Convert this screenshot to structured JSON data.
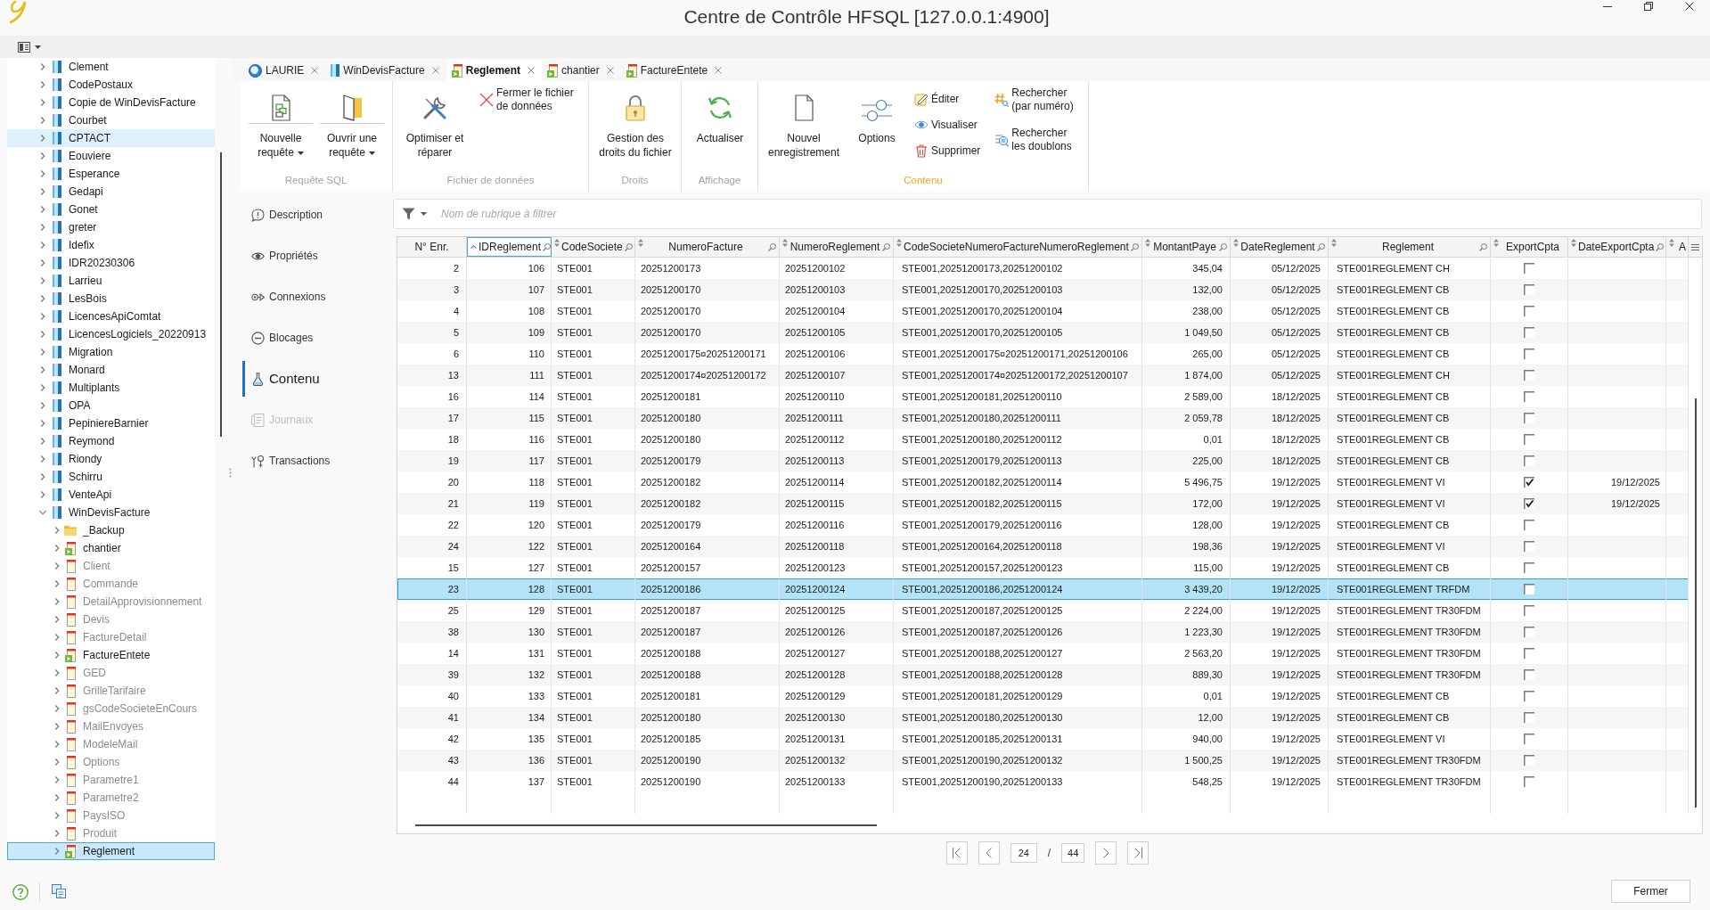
{
  "window": {
    "title": "Centre de Contrôle HFSQL [127.0.0.1:4900]"
  },
  "tree": {
    "items": [
      {
        "label": "Clement",
        "kind": "database",
        "expanded": false,
        "selected": false,
        "hovered": false
      },
      {
        "label": "CodePostaux",
        "kind": "database",
        "expanded": false,
        "selected": false,
        "hovered": false
      },
      {
        "label": "Copie de WinDevisFacture",
        "kind": "database",
        "expanded": false,
        "selected": false,
        "hovered": false
      },
      {
        "label": "Courbet",
        "kind": "database",
        "expanded": false,
        "selected": false,
        "hovered": false
      },
      {
        "label": "CPTACT",
        "kind": "database",
        "expanded": false,
        "selected": false,
        "hovered": true
      },
      {
        "label": "Eouviere",
        "kind": "database",
        "expanded": false,
        "selected": false,
        "hovered": false
      },
      {
        "label": "Esperance",
        "kind": "database",
        "expanded": false,
        "selected": false,
        "hovered": false
      },
      {
        "label": "Gedapi",
        "kind": "database",
        "expanded": false,
        "selected": false,
        "hovered": false
      },
      {
        "label": "Gonet",
        "kind": "database",
        "expanded": false,
        "selected": false,
        "hovered": false
      },
      {
        "label": "greter",
        "kind": "database",
        "expanded": false,
        "selected": false,
        "hovered": false
      },
      {
        "label": "Idefix",
        "kind": "database",
        "expanded": false,
        "selected": false,
        "hovered": false
      },
      {
        "label": "IDR20230306",
        "kind": "database",
        "expanded": false,
        "selected": false,
        "hovered": false
      },
      {
        "label": "Larrieu",
        "kind": "database",
        "expanded": false,
        "selected": false,
        "hovered": false
      },
      {
        "label": "LesBois",
        "kind": "database",
        "expanded": false,
        "selected": false,
        "hovered": false
      },
      {
        "label": "LicencesApiComtat",
        "kind": "database",
        "expanded": false,
        "selected": false,
        "hovered": false
      },
      {
        "label": "LicencesLogiciels_20220913",
        "kind": "database",
        "expanded": false,
        "selected": false,
        "hovered": false
      },
      {
        "label": "Migration",
        "kind": "database",
        "expanded": false,
        "selected": false,
        "hovered": false
      },
      {
        "label": "Monard",
        "kind": "database",
        "expanded": false,
        "selected": false,
        "hovered": false
      },
      {
        "label": "Multiplants",
        "kind": "database",
        "expanded": false,
        "selected": false,
        "hovered": false
      },
      {
        "label": "OPA",
        "kind": "database",
        "expanded": false,
        "selected": false,
        "hovered": false
      },
      {
        "label": "PepiniereBarnier",
        "kind": "database",
        "expanded": false,
        "selected": false,
        "hovered": false
      },
      {
        "label": "Reymond",
        "kind": "database",
        "expanded": false,
        "selected": false,
        "hovered": false
      },
      {
        "label": "Riondy",
        "kind": "database",
        "expanded": false,
        "selected": false,
        "hovered": false
      },
      {
        "label": "Schirru",
        "kind": "database",
        "expanded": false,
        "selected": false,
        "hovered": false
      },
      {
        "label": "VenteApi",
        "kind": "database",
        "expanded": false,
        "selected": false,
        "hovered": false
      },
      {
        "label": "WinDevisFacture",
        "kind": "database",
        "expanded": true,
        "selected": false,
        "hovered": false,
        "children": [
          {
            "label": "_Backup",
            "kind": "folder",
            "expanded": false,
            "selected": false,
            "hovered": false
          },
          {
            "label": "chantier",
            "kind": "file",
            "open": true,
            "expanded": false,
            "selected": false,
            "hovered": false
          },
          {
            "label": "Client",
            "kind": "file",
            "open": false,
            "expanded": false,
            "selected": false,
            "hovered": false
          },
          {
            "label": "Commande",
            "kind": "file",
            "open": false,
            "expanded": false,
            "selected": false,
            "hovered": false
          },
          {
            "label": "DetailApprovisionnement",
            "kind": "file",
            "open": false,
            "expanded": false,
            "selected": false,
            "hovered": false
          },
          {
            "label": "Devis",
            "kind": "file",
            "open": false,
            "expanded": false,
            "selected": false,
            "hovered": false
          },
          {
            "label": "FactureDetail",
            "kind": "file",
            "open": false,
            "expanded": false,
            "selected": false,
            "hovered": false
          },
          {
            "label": "FactureEntete",
            "kind": "file",
            "open": true,
            "expanded": false,
            "selected": false,
            "hovered": false
          },
          {
            "label": "GED",
            "kind": "file",
            "open": false,
            "expanded": false,
            "selected": false,
            "hovered": false
          },
          {
            "label": "GrilleTarifaire",
            "kind": "file",
            "open": false,
            "expanded": false,
            "selected": false,
            "hovered": false
          },
          {
            "label": "gsCodeSocieteEnCours",
            "kind": "file",
            "open": false,
            "expanded": false,
            "selected": false,
            "hovered": false
          },
          {
            "label": "MailEnvoyes",
            "kind": "file",
            "open": false,
            "expanded": false,
            "selected": false,
            "hovered": false
          },
          {
            "label": "ModeleMail",
            "kind": "file",
            "open": false,
            "expanded": false,
            "selected": false,
            "hovered": false
          },
          {
            "label": "Options",
            "kind": "file",
            "open": false,
            "expanded": false,
            "selected": false,
            "hovered": false
          },
          {
            "label": "Parametre1",
            "kind": "file",
            "open": false,
            "expanded": false,
            "selected": false,
            "hovered": false
          },
          {
            "label": "Parametre2",
            "kind": "file",
            "open": false,
            "expanded": false,
            "selected": false,
            "hovered": false
          },
          {
            "label": "PaysISO",
            "kind": "file",
            "open": false,
            "expanded": false,
            "selected": false,
            "hovered": false
          },
          {
            "label": "Produit",
            "kind": "file",
            "open": false,
            "expanded": false,
            "selected": false,
            "hovered": false
          },
          {
            "label": "Reglement",
            "kind": "file",
            "open": true,
            "expanded": false,
            "selected": true,
            "hovered": false
          }
        ]
      }
    ]
  },
  "tabs": [
    {
      "label": "LAURIE",
      "kind": "server",
      "selected": false
    },
    {
      "label": "WinDevisFacture",
      "kind": "database",
      "selected": false
    },
    {
      "label": "Reglement",
      "kind": "file",
      "selected": true
    },
    {
      "label": "chantier",
      "kind": "file",
      "selected": false
    },
    {
      "label": "FactureEntete",
      "kind": "file",
      "selected": false
    }
  ],
  "ribbon": {
    "groups": [
      {
        "label": "Requête SQL",
        "highlighted": false,
        "items": [
          {
            "kind": "large",
            "label": "Nouvelle requête",
            "dropdown": true
          },
          {
            "kind": "large",
            "label": "Ouvrir une requête",
            "dropdown": true
          }
        ]
      },
      {
        "label": "Fichier de données",
        "highlighted": false,
        "items": [
          {
            "kind": "large",
            "label": "Optimiser et réparer",
            "dropdown": false
          },
          {
            "kind": "stack",
            "buttons": [
              {
                "label": "Fermer le fichier de données"
              }
            ]
          }
        ]
      },
      {
        "label": "Droits",
        "highlighted": false,
        "items": [
          {
            "kind": "large",
            "label": "Gestion des droits du fichier",
            "dropdown": false
          }
        ]
      },
      {
        "label": "Affichage",
        "highlighted": false,
        "items": [
          {
            "kind": "large",
            "label": "Actualiser",
            "dropdown": false
          }
        ]
      },
      {
        "label": "Contenu",
        "highlighted": true,
        "items": [
          {
            "kind": "large",
            "label": "Nouvel enregistrement",
            "dropdown": false
          },
          {
            "kind": "large",
            "label": "Options",
            "dropdown": false
          },
          {
            "kind": "stack",
            "buttons": [
              {
                "label": "Éditer"
              },
              {
                "label": "Visualiser"
              },
              {
                "label": "Supprimer"
              }
            ]
          },
          {
            "kind": "stack",
            "buttons": [
              {
                "label": "Rechercher (par numéro)"
              },
              {
                "label": "Rechercher les doublons"
              }
            ]
          }
        ]
      }
    ]
  },
  "nav": {
    "items": [
      {
        "label": "Description",
        "selected": false,
        "disabled": false
      },
      {
        "label": "Propriétés",
        "selected": false,
        "disabled": false
      },
      {
        "label": "Connexions",
        "selected": false,
        "disabled": false
      },
      {
        "label": "Blocages",
        "selected": false,
        "disabled": false
      },
      {
        "label": "Contenu",
        "selected": true,
        "disabled": false
      },
      {
        "label": "Journaux",
        "selected": false,
        "disabled": true
      },
      {
        "label": "Transactions",
        "selected": false,
        "disabled": false
      }
    ]
  },
  "filter": {
    "placeholder": "Nom de rubrique à filtrer"
  },
  "table": {
    "columns": [
      {
        "label": "N° Enr.",
        "kind": "index",
        "sorted": false
      },
      {
        "label": "IDReglement",
        "kind": "field",
        "sorted": true
      },
      {
        "label": "CodeSociete",
        "kind": "field",
        "sorted": false
      },
      {
        "label": "NumeroFacture",
        "kind": "field",
        "sorted": false
      },
      {
        "label": "NumeroReglement",
        "kind": "field",
        "sorted": false
      },
      {
        "label": "CodeSocieteNumeroFactureNumeroReglement",
        "kind": "field",
        "sorted": false
      },
      {
        "label": "MontantPaye",
        "kind": "field",
        "sorted": false
      },
      {
        "label": "DateReglement",
        "kind": "field",
        "sorted": false
      },
      {
        "label": "Reglement",
        "kind": "field",
        "sorted": false
      },
      {
        "label": "ExportCpta",
        "kind": "flag",
        "sorted": false
      },
      {
        "label": "DateExportCpta",
        "kind": "field",
        "sorted": false
      },
      {
        "label": "A",
        "kind": "clipped",
        "sorted": false
      }
    ],
    "rows": [
      {
        "cells": [
          "2",
          "106",
          "STE001",
          "20251200173",
          "20251200102",
          "STE001,20251200173,20251200102",
          "345,04",
          "05/12/2025",
          "STE001REGLEMENT CH"
        ],
        "checked": false,
        "selected": false
      },
      {
        "cells": [
          "3",
          "107",
          "STE001",
          "20251200170",
          "20251200103",
          "STE001,20251200170,20251200103",
          "132,00",
          "05/12/2025",
          "STE001REGLEMENT CB"
        ],
        "checked": false,
        "selected": false
      },
      {
        "cells": [
          "4",
          "108",
          "STE001",
          "20251200170",
          "20251200104",
          "STE001,20251200170,20251200104",
          "238,00",
          "05/12/2025",
          "STE001REGLEMENT CB"
        ],
        "checked": false,
        "selected": false
      },
      {
        "cells": [
          "5",
          "109",
          "STE001",
          "20251200170",
          "20251200105",
          "STE001,20251200170,20251200105",
          "1 049,50",
          "05/12/2025",
          "STE001REGLEMENT CB"
        ],
        "checked": false,
        "selected": false
      },
      {
        "cells": [
          "6",
          "110",
          "STE001",
          "20251200175¤20251200171",
          "20251200106",
          "STE001,20251200175¤20251200171,20251200106",
          "265,00",
          "05/12/2025",
          "STE001REGLEMENT CB"
        ],
        "checked": false,
        "selected": false
      },
      {
        "cells": [
          "13",
          "111",
          "STE001",
          "20251200174¤20251200172",
          "20251200107",
          "STE001,20251200174¤20251200172,20251200107",
          "1 874,00",
          "05/12/2025",
          "STE001REGLEMENT CH"
        ],
        "checked": false,
        "selected": false
      },
      {
        "cells": [
          "16",
          "114",
          "STE001",
          "20251200181",
          "20251200110",
          "STE001,20251200181,20251200110",
          "2 589,00",
          "18/12/2025",
          "STE001REGLEMENT CB"
        ],
        "checked": false,
        "selected": false
      },
      {
        "cells": [
          "17",
          "115",
          "STE001",
          "20251200180",
          "20251200111",
          "STE001,20251200180,20251200111",
          "2 059,78",
          "18/12/2025",
          "STE001REGLEMENT CB"
        ],
        "checked": false,
        "selected": false
      },
      {
        "cells": [
          "18",
          "116",
          "STE001",
          "20251200180",
          "20251200112",
          "STE001,20251200180,20251200112",
          "0,01",
          "18/12/2025",
          "STE001REGLEMENT CB"
        ],
        "checked": false,
        "selected": false
      },
      {
        "cells": [
          "19",
          "117",
          "STE001",
          "20251200179",
          "20251200113",
          "STE001,20251200179,20251200113",
          "225,00",
          "18/12/2025",
          "STE001REGLEMENT CB"
        ],
        "checked": false,
        "selected": false
      },
      {
        "cells": [
          "20",
          "118",
          "STE001",
          "20251200182",
          "20251200114",
          "STE001,20251200182,20251200114",
          "5 496,75",
          "19/12/2025",
          "STE001REGLEMENT VI"
        ],
        "checked": true,
        "export_date": "19/12/2025",
        "selected": false
      },
      {
        "cells": [
          "21",
          "119",
          "STE001",
          "20251200182",
          "20251200115",
          "STE001,20251200182,20251200115",
          "172,00",
          "19/12/2025",
          "STE001REGLEMENT VI"
        ],
        "checked": true,
        "export_date": "19/12/2025",
        "selected": false
      },
      {
        "cells": [
          "22",
          "120",
          "STE001",
          "20251200179",
          "20251200116",
          "STE001,20251200179,20251200116",
          "128,00",
          "19/12/2025",
          "STE001REGLEMENT CB"
        ],
        "checked": false,
        "selected": false
      },
      {
        "cells": [
          "24",
          "122",
          "STE001",
          "20251200164",
          "20251200118",
          "STE001,20251200164,20251200118",
          "198,36",
          "19/12/2025",
          "STE001REGLEMENT VI"
        ],
        "checked": false,
        "selected": false
      },
      {
        "cells": [
          "15",
          "127",
          "STE001",
          "20251200157",
          "20251200123",
          "STE001,20251200157,20251200123",
          "115,00",
          "19/12/2025",
          "STE001REGLEMENT CB"
        ],
        "checked": false,
        "selected": false
      },
      {
        "cells": [
          "23",
          "128",
          "STE001",
          "20251200186",
          "20251200124",
          "STE001,20251200186,20251200124",
          "3 439,20",
          "19/12/2025",
          "STE001REGLEMENT TRFDM"
        ],
        "checked": false,
        "selected": true
      },
      {
        "cells": [
          "25",
          "129",
          "STE001",
          "20251200187",
          "20251200125",
          "STE001,20251200187,20251200125",
          "2 224,00",
          "19/12/2025",
          "STE001REGLEMENT TR30FDM"
        ],
        "checked": false,
        "selected": false
      },
      {
        "cells": [
          "38",
          "130",
          "STE001",
          "20251200187",
          "20251200126",
          "STE001,20251200187,20251200126",
          "1 223,30",
          "19/12/2025",
          "STE001REGLEMENT TR30FDM"
        ],
        "checked": false,
        "selected": false
      },
      {
        "cells": [
          "14",
          "131",
          "STE001",
          "20251200188",
          "20251200127",
          "STE001,20251200188,20251200127",
          "2 563,20",
          "19/12/2025",
          "STE001REGLEMENT TR30FDM"
        ],
        "checked": false,
        "selected": false
      },
      {
        "cells": [
          "39",
          "132",
          "STE001",
          "20251200188",
          "20251200128",
          "STE001,20251200188,20251200128",
          "889,30",
          "19/12/2025",
          "STE001REGLEMENT TR30FDM"
        ],
        "checked": false,
        "selected": false
      },
      {
        "cells": [
          "40",
          "133",
          "STE001",
          "20251200181",
          "20251200129",
          "STE001,20251200181,20251200129",
          "0,01",
          "19/12/2025",
          "STE001REGLEMENT CB"
        ],
        "checked": false,
        "selected": false
      },
      {
        "cells": [
          "41",
          "134",
          "STE001",
          "20251200180",
          "20251200130",
          "STE001,20251200180,20251200130",
          "12,00",
          "19/12/2025",
          "STE001REGLEMENT CB"
        ],
        "checked": false,
        "selected": false
      },
      {
        "cells": [
          "42",
          "135",
          "STE001",
          "20251200185",
          "20251200131",
          "STE001,20251200185,20251200131",
          "940,00",
          "19/12/2025",
          "STE001REGLEMENT VI"
        ],
        "checked": false,
        "selected": false
      },
      {
        "cells": [
          "43",
          "136",
          "STE001",
          "20251200190",
          "20251200132",
          "STE001,20251200190,20251200132",
          "1 500,25",
          "19/12/2025",
          "STE001REGLEMENT TR30FDM"
        ],
        "checked": false,
        "selected": false
      },
      {
        "cells": [
          "44",
          "137",
          "STE001",
          "20251200190",
          "20251200133",
          "STE001,20251200190,20251200133",
          "548,25",
          "19/12/2025",
          "STE001REGLEMENT TR30FDM"
        ],
        "checked": false,
        "selected": false
      }
    ]
  },
  "pager": {
    "current": "24",
    "separator": "/",
    "total": "44"
  },
  "footer": {
    "close_button": "Fermer"
  }
}
